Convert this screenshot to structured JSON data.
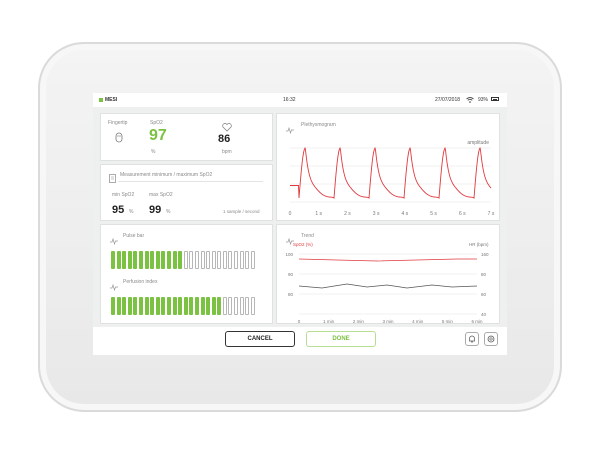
{
  "status": {
    "brand": "MESI",
    "time": "16:32",
    "date": "27/07/2018",
    "battery": "93%"
  },
  "spo2_panel": {
    "fingertip_label": "Fingertip",
    "spo2_label": "SpO2",
    "spo2_value": "97",
    "spo2_unit": "%",
    "hr_value": "86",
    "hr_unit": "bpm"
  },
  "measurement_panel": {
    "title": "Measurement minimum / maximum SpO2",
    "min_label": "min SpO2",
    "min_value": "95",
    "min_unit": "%",
    "max_label": "max SpO2",
    "max_value": "99",
    "max_unit": "%",
    "rate": "1 sample / second"
  },
  "bars_panel": {
    "pulse_label": "Pulse bar",
    "pulse_level": 0.5,
    "perfusion_label": "Perfusion index",
    "perfusion_level": 0.75,
    "accent": "#7cc242"
  },
  "pleth_panel": {
    "title": "Plethysmogram",
    "axis_label": "amplitude",
    "ticks": [
      "0",
      "1 s",
      "2 s",
      "3 s",
      "4 s",
      "5 s",
      "6 s",
      "7 s"
    ],
    "line_color": "#e0393e"
  },
  "trend_panel": {
    "title": "Trend",
    "left_label": "SpO2 (%)",
    "right_label": "HR (bpm)",
    "left_ticks": [
      "100",
      "90",
      "80"
    ],
    "right_ticks": [
      "160",
      "80",
      "60",
      "40"
    ],
    "x_ticks": [
      "0",
      "1 min",
      "2 min",
      "3 min",
      "4 min",
      "5 min",
      "6 min"
    ]
  },
  "footer": {
    "cancel": "CANCEL",
    "done": "DONE"
  }
}
